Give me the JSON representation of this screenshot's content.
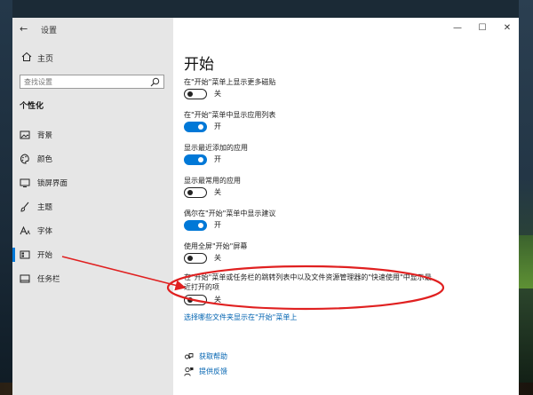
{
  "app_title": "设置",
  "home_label": "主页",
  "search": {
    "placeholder": "查找设置"
  },
  "section_heading": "个性化",
  "sidebar_items": [
    {
      "label": "背景",
      "icon": "picture-icon"
    },
    {
      "label": "颜色",
      "icon": "palette-icon"
    },
    {
      "label": "锁屏界面",
      "icon": "lock-screen-icon"
    },
    {
      "label": "主题",
      "icon": "brush-icon"
    },
    {
      "label": "字体",
      "icon": "font-icon"
    },
    {
      "label": "开始",
      "icon": "start-icon",
      "active": true
    },
    {
      "label": "任务栏",
      "icon": "taskbar-icon"
    }
  ],
  "page_title": "开始",
  "settings": [
    {
      "label": "在\"开始\"菜单上显示更多磁贴",
      "state": "关",
      "on": false
    },
    {
      "label": "在\"开始\"菜单中显示应用列表",
      "state": "开",
      "on": true
    },
    {
      "label": "显示最近添加的应用",
      "state": "开",
      "on": true
    },
    {
      "label": "显示最常用的应用",
      "state": "关",
      "on": false
    },
    {
      "label": "偶尔在\"开始\"菜单中显示建议",
      "state": "开",
      "on": true
    },
    {
      "label": "使用全屏\"开始\"屏幕",
      "state": "关",
      "on": false
    }
  ],
  "recent_items": {
    "label": "在\"开始\"菜单或任务栏的跳转列表中以及文件资源管理器的\"快速使用\"中显示最近打开的项",
    "state": "关",
    "on": false
  },
  "folders_link": "选择哪些文件夹显示在\"开始\"菜单上",
  "help_links": [
    {
      "label": "获取帮助",
      "icon": "help-icon"
    },
    {
      "label": "提供反馈",
      "icon": "feedback-icon"
    }
  ],
  "annotation_color": "#e02020"
}
